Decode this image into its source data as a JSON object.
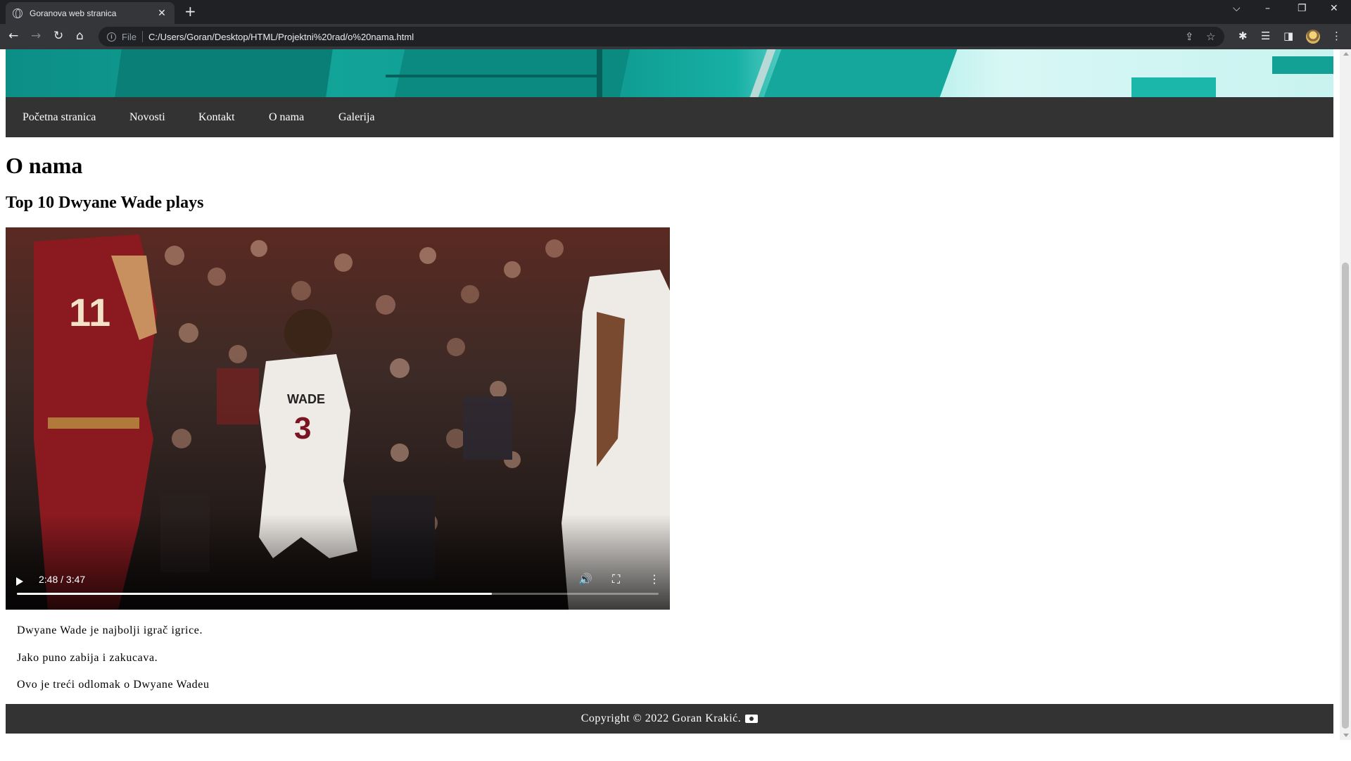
{
  "browser": {
    "tab_title": "Goranova web stranica",
    "tab_close": "✕",
    "new_tab": "+",
    "scheme_label": "File",
    "url": "C:/Users/Goran/Desktop/HTML/Projektni%20rad/o%20nama.html",
    "window_controls": {
      "tab_search": "⌵",
      "minimize": "–",
      "restore": "❐",
      "close": "✕"
    },
    "nav": {
      "back": "←",
      "forward": "→",
      "reload": "↻",
      "home": "⌂"
    },
    "tools": {
      "share": "⇪",
      "bookmark": "☆",
      "extensions": "✱",
      "reading_list": "☰",
      "side_panel": "◨",
      "menu": "⋮"
    }
  },
  "page": {
    "nav_links": [
      "Početna stranica",
      "Novosti",
      "Kontakt",
      "O nama",
      "Galerija"
    ],
    "heading": "O nama",
    "subheading": "Top 10 Dwyane Wade plays",
    "video": {
      "time": "2:48 / 3:47",
      "progress": 0.74,
      "volume_icon": "🔊",
      "fullscreen_icon": "⛶",
      "more_icon": "⋮"
    },
    "paragraphs": [
      "Dwyane Wade je najbolji igrač igrice.",
      "Jako puno zabija i zakucava.",
      "Ovo je treći odlomak o Dwyane Wadeu"
    ],
    "footer_text": "Copyright © 2022 Goran Krakić."
  },
  "colors": {
    "chrome_dark": "#202124",
    "chrome_toolbar": "#35363a",
    "navbar": "#333333",
    "banner_teal": "#12a399"
  }
}
